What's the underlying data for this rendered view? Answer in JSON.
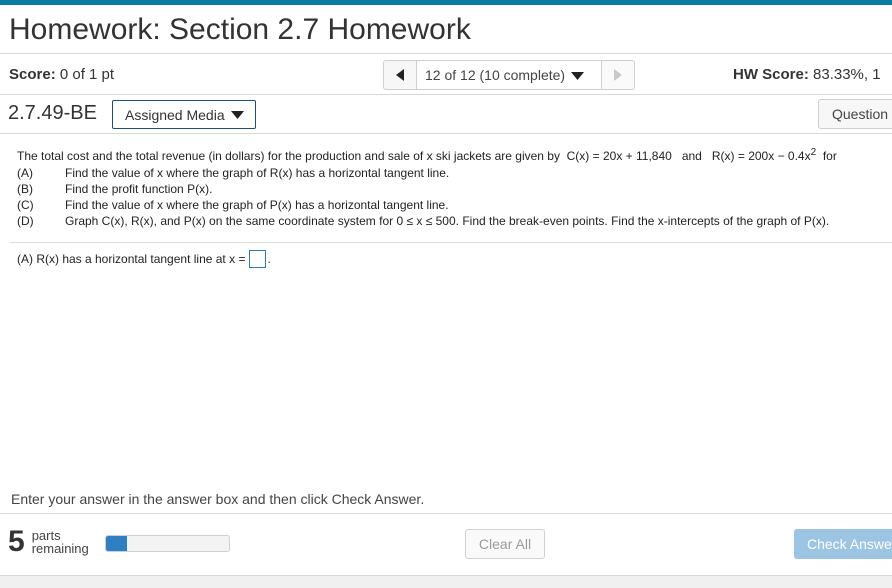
{
  "header": {
    "title": "Homework: Section 2.7 Homework"
  },
  "score_row": {
    "score_label": "Score:",
    "score_value": "0 of 1 pt",
    "nav_position": "12 of 12 (10 complete)",
    "hw_score_label": "HW Score:",
    "hw_score_value": "83.33%, 1"
  },
  "question_row": {
    "question_id": "2.7.49-BE",
    "assigned_media_label": "Assigned Media",
    "question_help_label": "Question Help"
  },
  "problem": {
    "statement_prefix": "The total cost and the total revenue (in dollars) for the production and sale of x ski jackets are given by",
    "cost_function": "C(x) = 20x + 11,840",
    "and": "and",
    "revenue_function_main": "R(x) = 200x − 0.4x",
    "revenue_exponent": "2",
    "statement_suffix": "for",
    "parts": [
      {
        "label": "(A)",
        "text": "Find the value of x where the graph of R(x) has a horizontal tangent line."
      },
      {
        "label": "(B)",
        "text": "Find the profit function P(x)."
      },
      {
        "label": "(C)",
        "text": "Find the value of x where the graph of P(x) has a horizontal tangent line."
      },
      {
        "label": "(D)",
        "text": "Graph C(x), R(x), and P(x) on the same coordinate system for 0 ≤ x ≤ 500. Find the break-even points. Find the x-intercepts of the graph of P(x)."
      }
    ]
  },
  "answer": {
    "prompt": "(A) R(x) has a horizontal tangent line at x =",
    "value": "",
    "suffix": "."
  },
  "footer": {
    "instruction": "Enter your answer in the answer box and then click Check Answer.",
    "parts_remaining_count": "5",
    "parts_label_1": "parts",
    "parts_label_2": "remaining",
    "progress_fraction": 0.17,
    "clear_all_label": "Clear All",
    "check_answer_label": "Check Answer"
  },
  "colors": {
    "accent_bar": "#0b7da0",
    "progress_fill": "#2f80c2",
    "check_button": "#9cc5e4",
    "answer_box_border": "#2a7ab8"
  }
}
